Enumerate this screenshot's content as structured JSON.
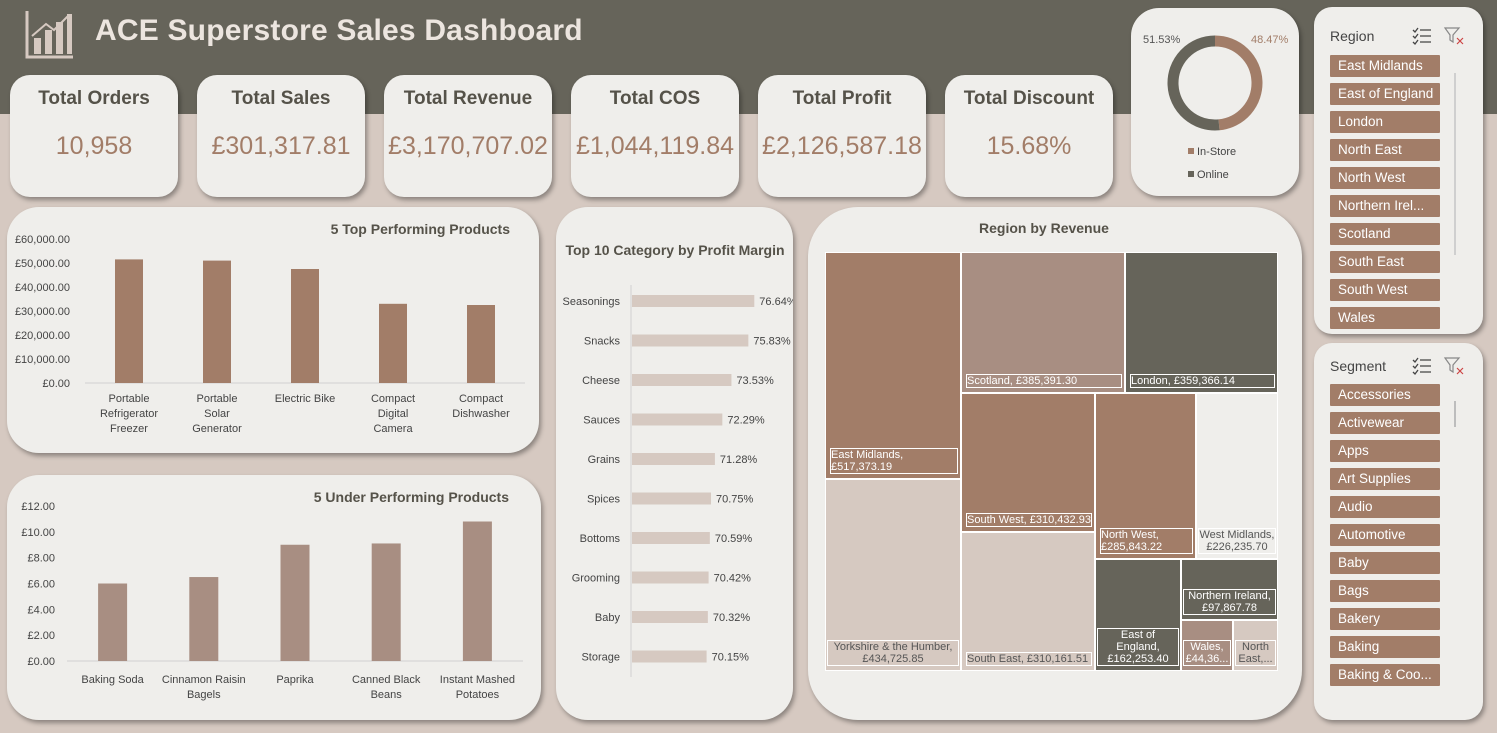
{
  "header": {
    "title": "ACE Superstore Sales Dashboard",
    "logo_icon": "bar-chart-icon"
  },
  "kpis": [
    {
      "label": "Total Orders",
      "value": "10,958"
    },
    {
      "label": "Total Sales",
      "value": "£301,317.81"
    },
    {
      "label": "Total Revenue",
      "value": "£3,170,707.02"
    },
    {
      "label": "Total COS",
      "value": "£1,044,119.84"
    },
    {
      "label": "Total Profit",
      "value": "£2,126,587.18"
    },
    {
      "label": "Total Discount",
      "value": "15.68%"
    }
  ],
  "colors": {
    "accent": "#a27d68",
    "dark": "#66645a",
    "light": "#d6c9c1",
    "mid": "#a88e82",
    "pale": "#d6c9c1"
  },
  "donut": {
    "left_label": "51.53%",
    "right_label": "48.47%",
    "legend": [
      "In-Store",
      "Online"
    ]
  },
  "region_slicer": {
    "title": "Region",
    "items": [
      "East Midlands",
      "East of England",
      "London",
      "North East",
      "North West",
      "Northern Irel...",
      "Scotland",
      "South East",
      "South West",
      "Wales"
    ]
  },
  "segment_slicer": {
    "title": "Segment",
    "items": [
      "Accessories",
      "Activewear",
      "Apps",
      "Art Supplies",
      "Audio",
      "Automotive",
      "Baby",
      "Bags",
      "Bakery",
      "Baking",
      "Baking & Coo..."
    ]
  },
  "chart_data": [
    {
      "type": "bar",
      "title": "5 Top Performing Products",
      "categories": [
        "Portable Refrigerator Freezer",
        "Portable Solar Generator",
        "Electric Bike",
        "Compact Digital Camera",
        "Compact Dishwasher"
      ],
      "values": [
        51500,
        51000,
        47500,
        33000,
        32500
      ],
      "ylim": [
        0,
        60000
      ],
      "yticks": [
        "£0.00",
        "£10,000.00",
        "£20,000.00",
        "£30,000.00",
        "£40,000.00",
        "£50,000.00",
        "£60,000.00"
      ]
    },
    {
      "type": "bar",
      "title": "5 Under Performing Products",
      "categories": [
        "Baking Soda",
        "Cinnamon Raisin Bagels",
        "Paprika",
        "Canned Black Beans",
        "Instant Mashed Potatoes"
      ],
      "values": [
        6.0,
        6.5,
        9.0,
        9.1,
        10.8
      ],
      "ylim": [
        0,
        12
      ],
      "yticks": [
        "£0.00",
        "£2.00",
        "£4.00",
        "£6.00",
        "£8.00",
        "£10.00",
        "£12.00"
      ]
    },
    {
      "type": "bar",
      "orientation": "horizontal",
      "title": "Top 10 Category by Profit Margin",
      "categories": [
        "Seasonings",
        "Snacks",
        "Cheese",
        "Sauces",
        "Grains",
        "Spices",
        "Bottoms",
        "Grooming",
        "Baby",
        "Storage"
      ],
      "values": [
        76.64,
        75.83,
        73.53,
        72.29,
        71.28,
        70.75,
        70.59,
        70.42,
        70.32,
        70.15
      ],
      "data_labels": [
        "76.64%",
        "75.83%",
        "73.53%",
        "72.29%",
        "71.28%",
        "70.75%",
        "70.59%",
        "70.42%",
        "70.32%",
        "70.15%"
      ]
    },
    {
      "type": "pie",
      "variant": "donut",
      "labels": [
        "In-Store",
        "Online"
      ],
      "values": [
        48.47,
        51.53
      ]
    },
    {
      "type": "treemap",
      "title": "Region by Revenue",
      "items": [
        {
          "label": "East Midlands, £517,373.19",
          "value": 517373.19
        },
        {
          "label": "Yorkshire & the Humber, £434,725.85",
          "value": 434725.85
        },
        {
          "label": "Scotland, £385,391.30",
          "value": 385391.3
        },
        {
          "label": "London, £359,366.14",
          "value": 359366.14
        },
        {
          "label": "South West, £310,432.93",
          "value": 310432.93
        },
        {
          "label": "South East, £310,161.51",
          "value": 310161.51
        },
        {
          "label": "North West, £285,843.22",
          "value": 285843.22
        },
        {
          "label": "West Midlands, £226,235.70",
          "value": 226235.7
        },
        {
          "label": "East of England, £162,253.40",
          "value": 162253.4
        },
        {
          "label": "Northern Ireland, £97,867.78",
          "value": 97867.78
        },
        {
          "label": "Wales, £44,36...",
          "value": 44360
        },
        {
          "label": "North East,...",
          "value": 40000
        }
      ]
    }
  ]
}
